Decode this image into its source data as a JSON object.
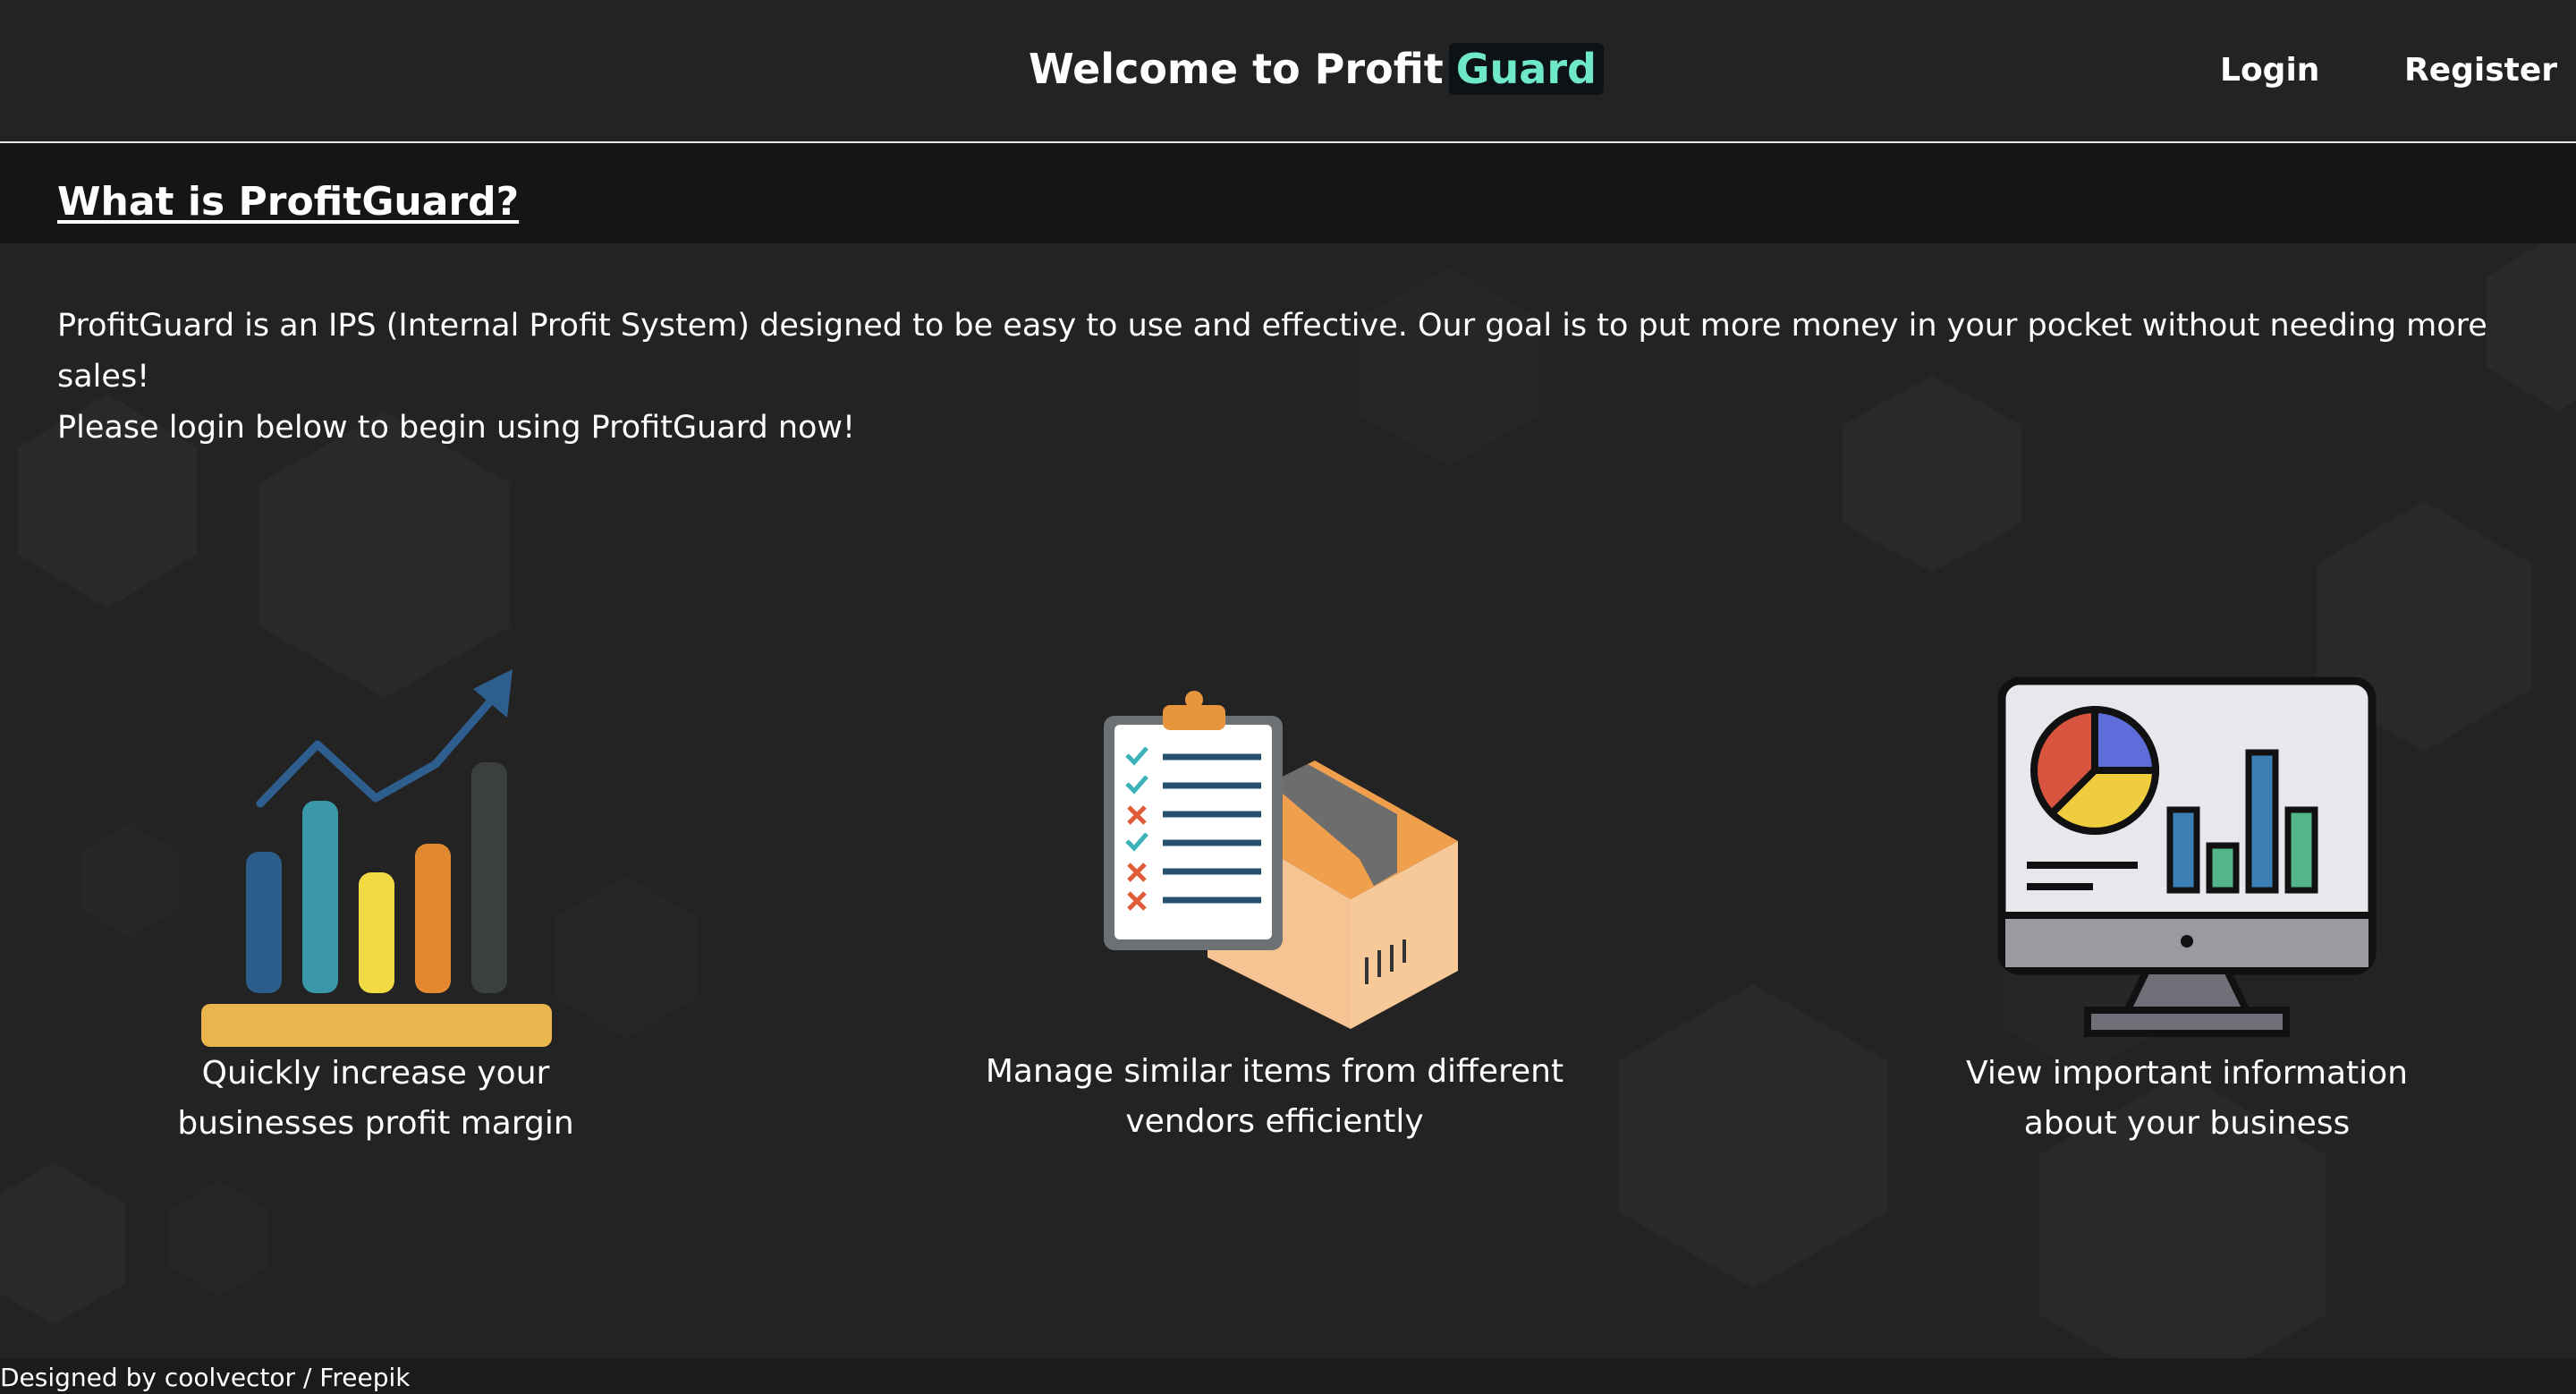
{
  "header": {
    "title_prefix": "Welcome to Profit",
    "title_highlight": "Guard",
    "nav": {
      "login": "Login",
      "register": "Register"
    }
  },
  "about": {
    "heading": "What is ProfitGuard?",
    "paragraph_line1": "ProfitGuard is an IPS (Internal Profit System) designed to be easy to use and effective. Our goal is to put more money in your pocket without needing more sales!",
    "paragraph_line2": "Please login below to begin using ProfitGuard now!"
  },
  "features": [
    {
      "icon": "growth-chart-icon",
      "caption_line1": "Quickly increase your",
      "caption_line2": "businesses profit margin"
    },
    {
      "icon": "inventory-checklist-icon",
      "caption_line1": "Manage similar items from different",
      "caption_line2": "vendors efficiently"
    },
    {
      "icon": "dashboard-monitor-icon",
      "caption_line1": "View important information",
      "caption_line2": "about your business"
    }
  ],
  "footer": {
    "credit": "Designed by coolvector / Freepik"
  },
  "colors": {
    "background": "#232323",
    "accent": "#6ee8c8",
    "band": "#151515"
  }
}
